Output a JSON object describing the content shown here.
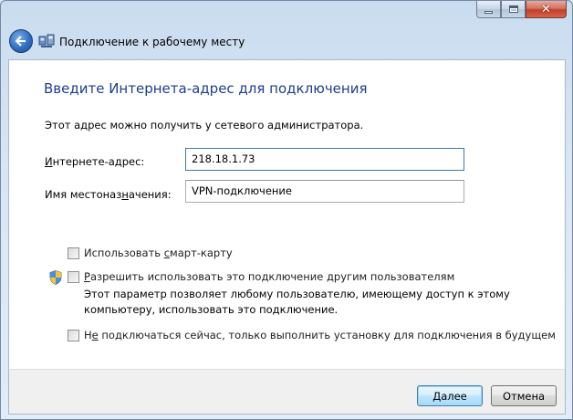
{
  "window": {
    "title": "Подключение к рабочему месту"
  },
  "page": {
    "heading": "Введите Интернета-адрес для подключения",
    "hint": "Этот адрес можно получить у сетевого администратора."
  },
  "fields": {
    "address": {
      "label_underlined": "И",
      "label_rest": "нтернете-адрес:",
      "value": "218.18.1.73"
    },
    "destination": {
      "label_pre": "Имя местоназ",
      "label_underlined": "н",
      "label_post": "ачения:",
      "value": "VPN-подключение"
    }
  },
  "options": {
    "smartcard": {
      "label_pre": "Использовать ",
      "label_underlined": "с",
      "label_post": "март-карту",
      "checked": false
    },
    "allow_others": {
      "label_underlined": "Р",
      "label_rest": "азрешить использовать это подключение другим пользователям",
      "description_line1": "Этот параметр позволяет любому пользователю, имеющему доступ к этому",
      "description_line2": "компьютеру, использовать это подключение.",
      "checked": false,
      "icon": "uac-shield-icon"
    },
    "dont_connect": {
      "label_pre": "Н",
      "label_underlined": "е",
      "label_post": " подключаться сейчас, только выполнить установку для подключения в будущем",
      "checked": false
    }
  },
  "buttons": {
    "next": "Далее",
    "cancel": "Отмена"
  },
  "colors": {
    "heading": "#1e3d8c",
    "default_button_border": "#3c7fb1"
  }
}
